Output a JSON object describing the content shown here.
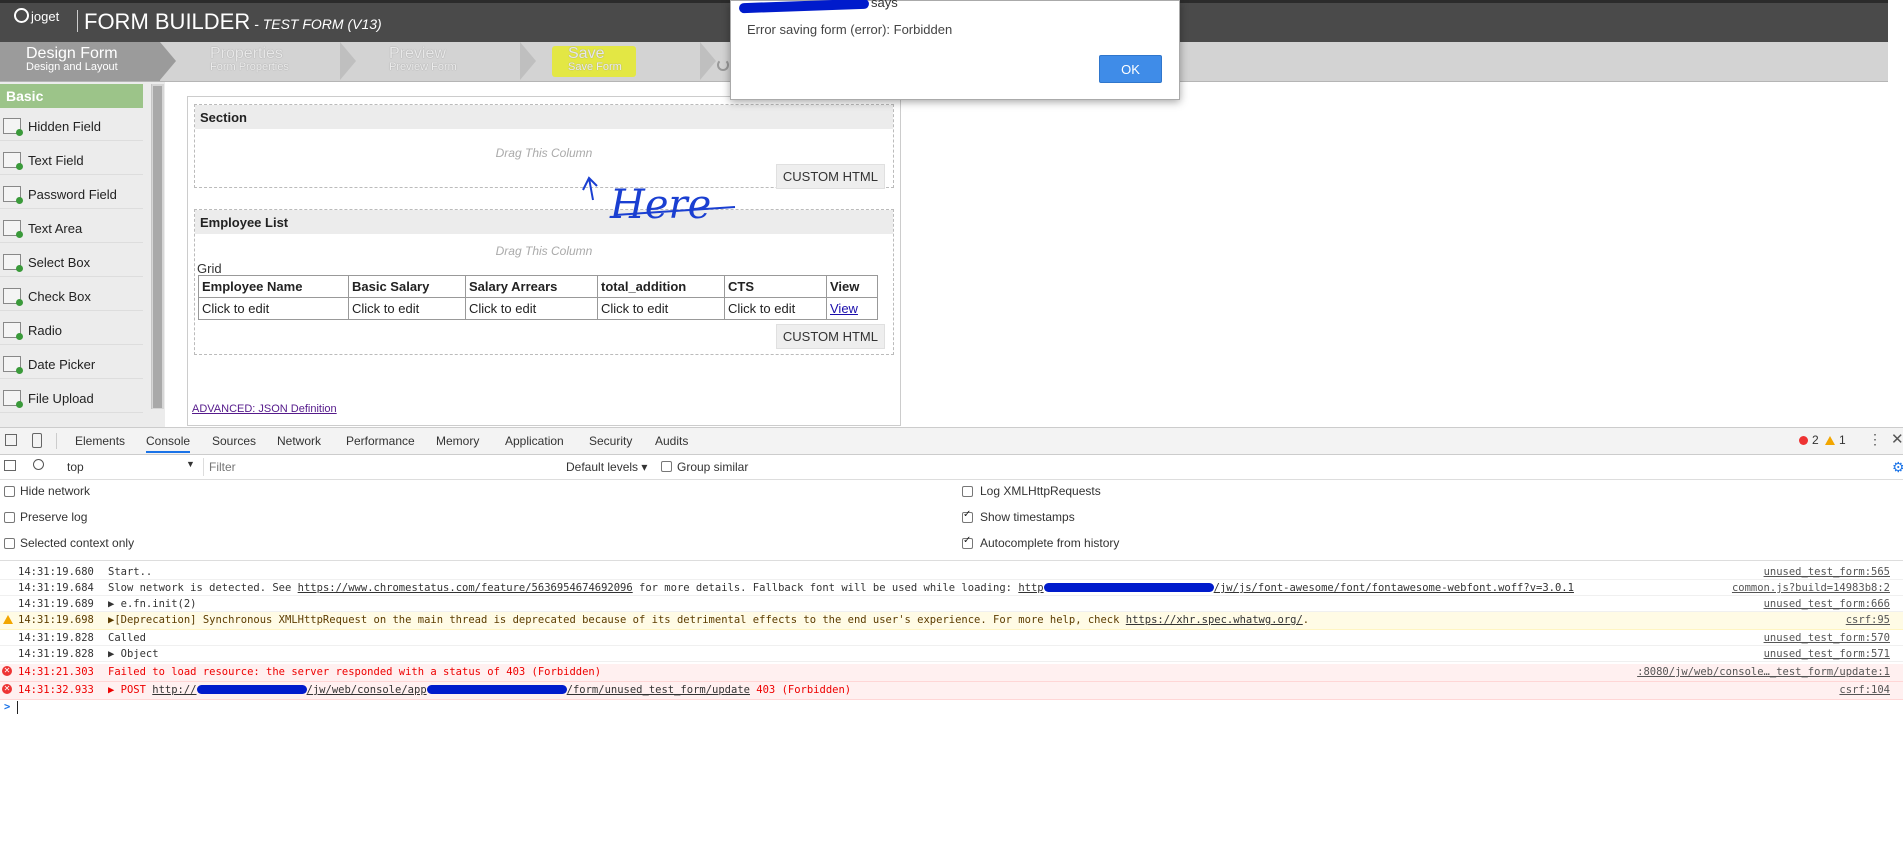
{
  "header": {
    "logo_text": "joget",
    "title": "FORM BUILDER",
    "subtitle": " - TEST FORM (V13)"
  },
  "steps": [
    {
      "title": "Design Form",
      "subtitle": "Design and Layout"
    },
    {
      "title": "Properties",
      "subtitle": "Form Properties"
    },
    {
      "title": "Preview",
      "subtitle": "Preview Form"
    },
    {
      "title": "Save",
      "subtitle": "Save Form"
    }
  ],
  "alert": {
    "title_suffix": "says",
    "message": "Error saving form (error): Forbidden",
    "ok_label": "OK"
  },
  "palette": {
    "header": "Basic",
    "items": [
      "Hidden Field",
      "Text Field",
      "Password Field",
      "Text Area",
      "Select Box",
      "Check Box",
      "Radio",
      "Date Picker",
      "File Upload"
    ]
  },
  "canvas": {
    "section1": {
      "title": "Section",
      "drag": "Drag This Column",
      "custom_html": "CUSTOM HTML"
    },
    "section2": {
      "title": "Employee List",
      "drag": "Drag This Column",
      "grid_label": "Grid",
      "columns": [
        "Employee Name",
        "Basic Salary",
        "Salary Arrears",
        "total_addition",
        "CTS",
        "View"
      ],
      "row": [
        "Click to edit",
        "Click to edit",
        "Click to edit",
        "Click to edit",
        "Click to edit",
        "View"
      ],
      "custom_html": "CUSTOM HTML"
    },
    "json_link": "ADVANCED: JSON Definition"
  },
  "annotation": {
    "text": "Here"
  },
  "devtools": {
    "tabs": [
      "Elements",
      "Console",
      "Sources",
      "Network",
      "Performance",
      "Memory",
      "Application",
      "Security",
      "Audits"
    ],
    "error_count": "2",
    "warning_count": "1",
    "context": "top",
    "filter_placeholder": "Filter",
    "levels": "Default levels ▾",
    "group_similar": "Group similar",
    "options_left": [
      "Hide network",
      "Preserve log",
      "Selected context only"
    ],
    "options_right": [
      {
        "label": "Log XMLHttpRequests",
        "checked": false
      },
      {
        "label": "Show timestamps",
        "checked": true
      },
      {
        "label": "Autocomplete from history",
        "checked": true
      }
    ],
    "logs": [
      {
        "ts": "14:31:19.680",
        "msg": "Start..",
        "src": "unused_test_form:565",
        "level": "log"
      },
      {
        "ts": "14:31:19.684",
        "msg_pre": "Slow network is detected. See ",
        "link": "https://www.chromestatus.com/feature/5636954674692096",
        "msg_post": " for more details. Fallback font will be used while loading: ",
        "link2_pre": "http",
        "link2_post": "/jw/js/font-awesome/font/fontawesome-webfont.woff?v=3.0.1",
        "src": "common.js?build=14983b8:2",
        "level": "log"
      },
      {
        "ts": "14:31:19.689",
        "msg": "▶ e.fn.init(2)",
        "src": "unused_test_form:666",
        "level": "log"
      },
      {
        "ts": "14:31:19.698",
        "msg_pre": "▶[Deprecation] Synchronous XMLHttpRequest on the main thread is deprecated because of its detrimental effects to the end user's experience. For more help, check ",
        "link": "https://xhr.spec.whatwg.org/",
        "msg_post": ".",
        "src": "csrf:95",
        "level": "warn"
      },
      {
        "ts": "14:31:19.828",
        "msg": "Called",
        "src": "unused_test_form:570",
        "level": "log"
      },
      {
        "ts": "14:31:19.828",
        "msg": "▶ Object",
        "src": "unused_test_form:571",
        "level": "log"
      },
      {
        "ts": "14:31:21.303",
        "msg": "Failed to load resource: the server responded with a status of 403 (Forbidden)",
        "src": ":8080/jw/web/console…_test_form/update:1",
        "level": "err"
      },
      {
        "ts": "14:31:32.933",
        "msg_pre": "▶ POST ",
        "link_a": "http://",
        "link_b": "/jw/web/console/app",
        "link_c": "/form/unused_test_form/update",
        "msg_post": " 403 (Forbidden)",
        "src": "csrf:104",
        "level": "err"
      }
    ],
    "prompt": ">"
  }
}
